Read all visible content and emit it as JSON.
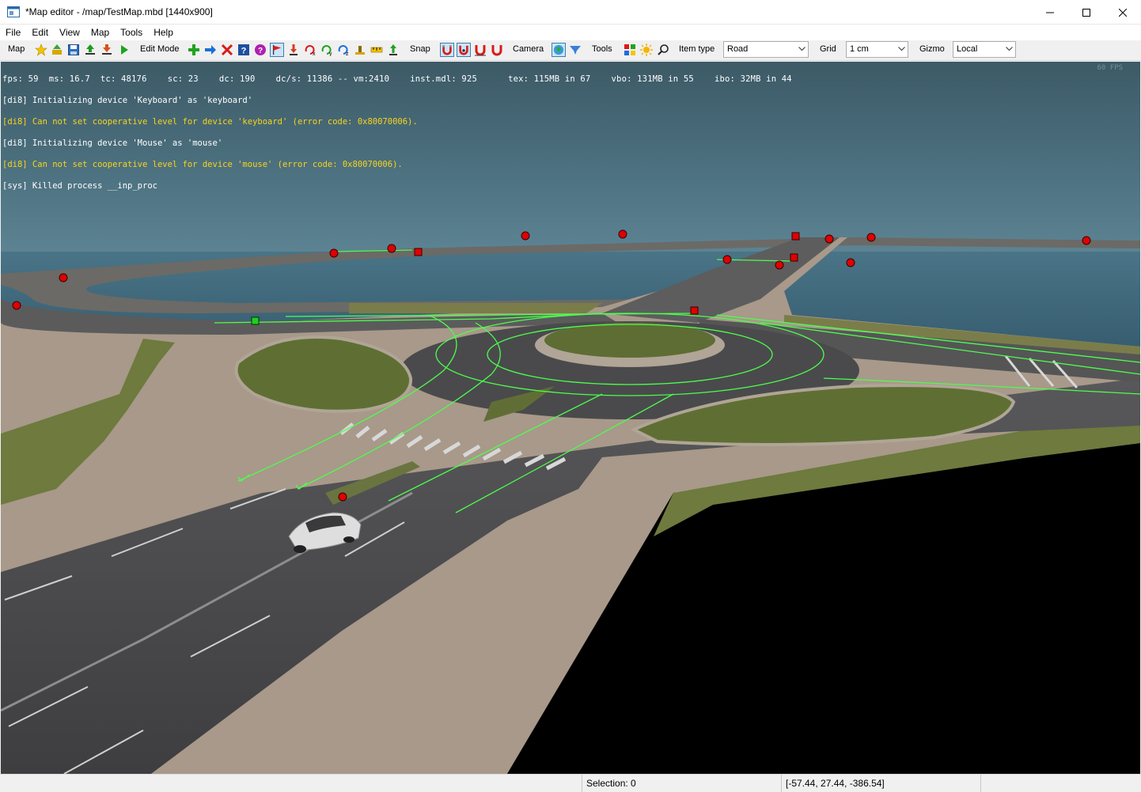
{
  "window": {
    "title": "*Map editor - /map/TestMap.mbd [1440x900]"
  },
  "menu": [
    "File",
    "Edit",
    "View",
    "Map",
    "Tools",
    "Help"
  ],
  "toolbar": {
    "map_label": "Map",
    "edit_mode_label": "Edit Mode",
    "snap_label": "Snap",
    "camera_label": "Camera",
    "tools_label": "Tools",
    "item_type_label": "Item type",
    "item_type_value": "Road",
    "grid_label": "Grid",
    "grid_value": "1 cm",
    "gizmo_label": "Gizmo",
    "gizmo_value": "Local"
  },
  "hud": {
    "stats": "fps: 59  ms: 16.7  tc: 48176    sc: 23    dc: 190    dc/s: 11386 -- vm:2410    inst.mdl: 925      tex: 115MB in 67    vbo: 131MB in 55    ibo: 32MB in 44",
    "fps_ghost": "60 FPS",
    "log": [
      {
        "text": "[di8] Initializing device 'Keyboard' as 'keyboard'",
        "level": "info"
      },
      {
        "text": "[di8] Can not set cooperative level for device 'keyboard' (error code: 0x80070006).",
        "level": "warn"
      },
      {
        "text": "[di8] Initializing device 'Mouse' as 'mouse'",
        "level": "info"
      },
      {
        "text": "[di8] Can not set cooperative level for device 'mouse' (error code: 0x80070006).",
        "level": "warn"
      },
      {
        "text": "[sys] Killed process __inp_proc",
        "level": "info"
      }
    ]
  },
  "status": {
    "selection": "Selection: 0",
    "coords": "[-57.44, 27.44, -386.54]"
  },
  "colors": {
    "accent": "#3c7fb1",
    "node_red": "#e00000",
    "node_green": "#1fcf1f",
    "spline_green": "#4cff4c",
    "log_warn": "#f7d51d"
  }
}
